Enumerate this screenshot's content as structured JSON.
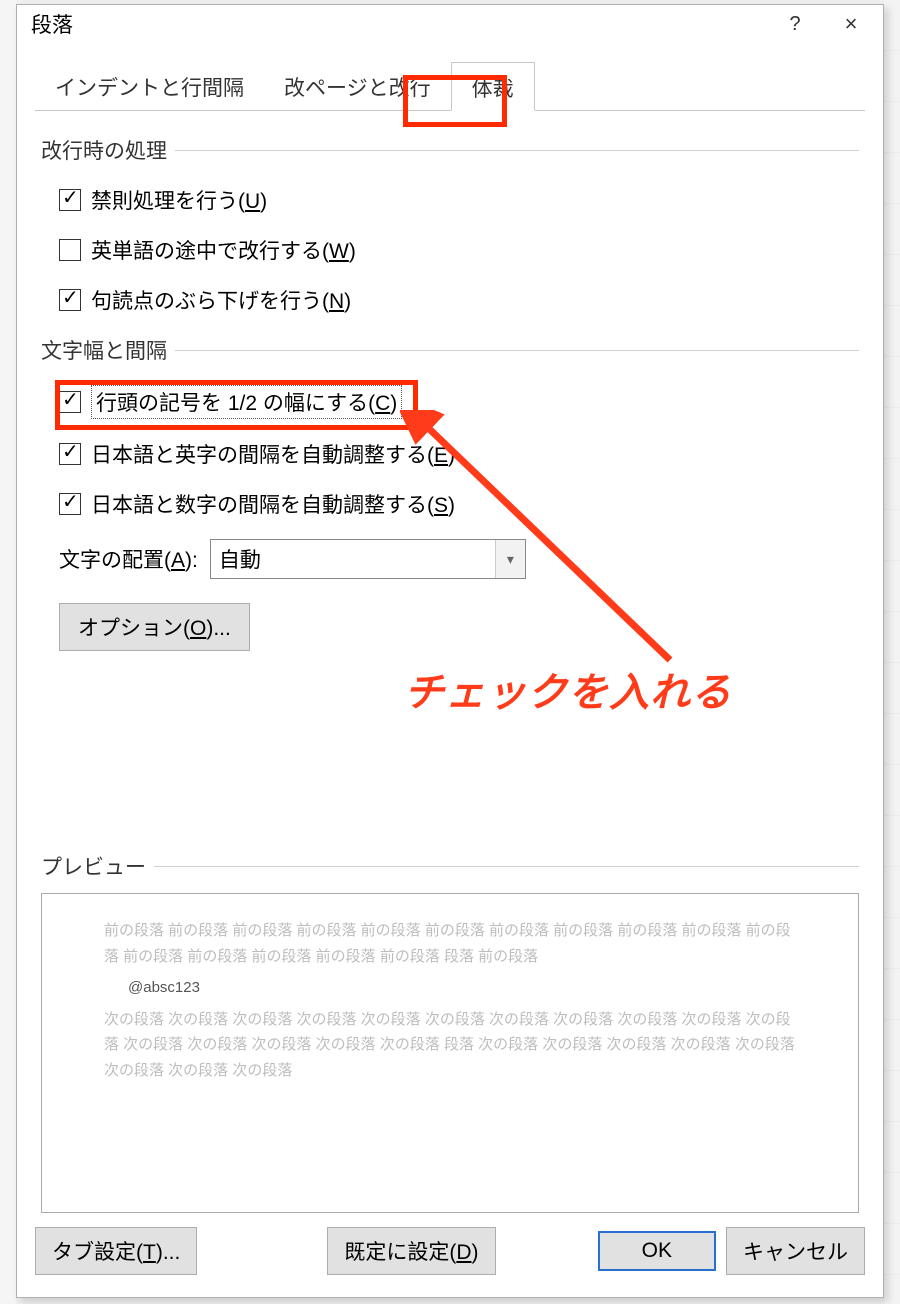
{
  "dialog": {
    "title": "段落",
    "help_tooltip": "?",
    "close_tooltip": "×"
  },
  "tabs": [
    {
      "label": "インデントと行間隔",
      "active": false
    },
    {
      "label": "改ページと改行",
      "active": false
    },
    {
      "label": "体裁",
      "active": true
    }
  ],
  "groups": {
    "linebreak": {
      "title": "改行時の処理",
      "options": [
        {
          "label": "禁則処理を行う(",
          "accel": "U",
          "tail": ")",
          "checked": true
        },
        {
          "label": "英単語の途中で改行する(",
          "accel": "W",
          "tail": ")",
          "checked": false
        },
        {
          "label": "句読点のぶら下げを行う(",
          "accel": "N",
          "tail": ")",
          "checked": true
        }
      ]
    },
    "spacing": {
      "title": "文字幅と間隔",
      "options": [
        {
          "label": "行頭の記号を 1/2 の幅にする(",
          "accel": "C",
          "tail": ")",
          "checked": true,
          "highlighted": true
        },
        {
          "label": "日本語と英字の間隔を自動調整する(",
          "accel": "E",
          "tail": ")",
          "checked": true
        },
        {
          "label": "日本語と数字の間隔を自動調整する(",
          "accel": "S",
          "tail": ")",
          "checked": true
        }
      ],
      "align_label_pre": "文字の配置(",
      "align_accel": "A",
      "align_label_post": "):",
      "align_value": "自動",
      "options_button_pre": "オプション(",
      "options_button_accel": "O",
      "options_button_post": ")..."
    }
  },
  "annotation": "チェックを入れる",
  "preview": {
    "title": "プレビュー",
    "prev_para": "前の段落 前の段落 前の段落 前の段落 前の段落 前の段落 前の段落 前の段落 前の段落 前の段落 前の段落 前の段落 前の段落 前の段落 前の段落 前の段落 段落 前の段落",
    "sample": "@absc123",
    "next_para": "次の段落 次の段落 次の段落 次の段落 次の段落 次の段落 次の段落 次の段落 次の段落 次の段落 次の段落 次の段落 次の段落 次の段落 次の段落 次の段落 段落 次の段落 次の段落 次の段落 次の段落 次の段落 次の段落 次の段落 次の段落"
  },
  "footer": {
    "tab_btn_pre": "タブ設定(",
    "tab_btn_accel": "T",
    "tab_btn_post": ")...",
    "default_btn_pre": "既定に設定(",
    "default_btn_accel": "D",
    "default_btn_post": ")",
    "ok": "OK",
    "cancel": "キャンセル"
  }
}
